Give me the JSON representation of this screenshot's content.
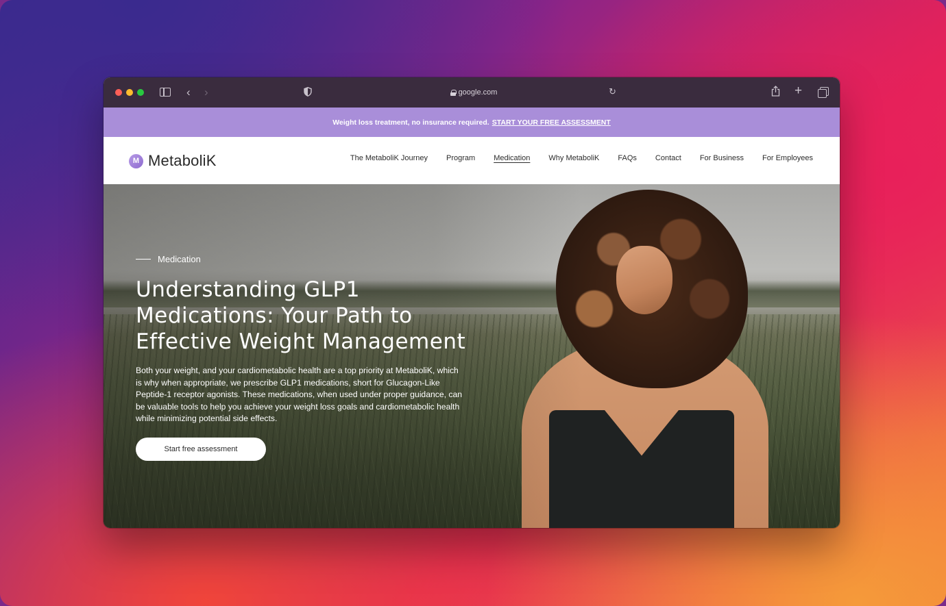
{
  "browser": {
    "address": "google.com",
    "icons": [
      "sidebar-icon",
      "back-icon",
      "forward-icon",
      "shield-icon",
      "lock-icon",
      "reload-icon",
      "share-icon",
      "plus-icon",
      "tabs-icon"
    ]
  },
  "announcement": {
    "text": "Weight loss treatment, no insurance required.",
    "link": "START YOUR FREE ASSESSMENT"
  },
  "nav": {
    "logo_mark": "M",
    "logo_text": "MetaboliK",
    "links": [
      {
        "label": "The MetaboliK Journey"
      },
      {
        "label": "Program"
      },
      {
        "label": "Medication",
        "active": true
      },
      {
        "label": "Why MetaboliK"
      },
      {
        "label": "FAQs"
      },
      {
        "label": "Contact"
      },
      {
        "label": "For Business"
      },
      {
        "label": "For Employees"
      }
    ]
  },
  "hero": {
    "eyebrow": "Medication",
    "title": "Understanding GLP1 Medications: Your Path to Effective Weight Management",
    "body": "Both your weight, and your cardiometabolic health are a top priority at MetaboliK, which is why when appropriate, we prescribe GLP1 medications, short for Glucagon-Like Peptide-1 receptor agonists. These medications, when used under proper guidance, can be valuable tools to help you achieve your weight loss goals and cardiometabolic health while minimizing potential side effects.",
    "cta": "Start free assessment"
  },
  "colors": {
    "announcement_bg": "#a98ed9",
    "toolbar_bg": "#3a2c3e",
    "brand": "#8e6cd0"
  }
}
